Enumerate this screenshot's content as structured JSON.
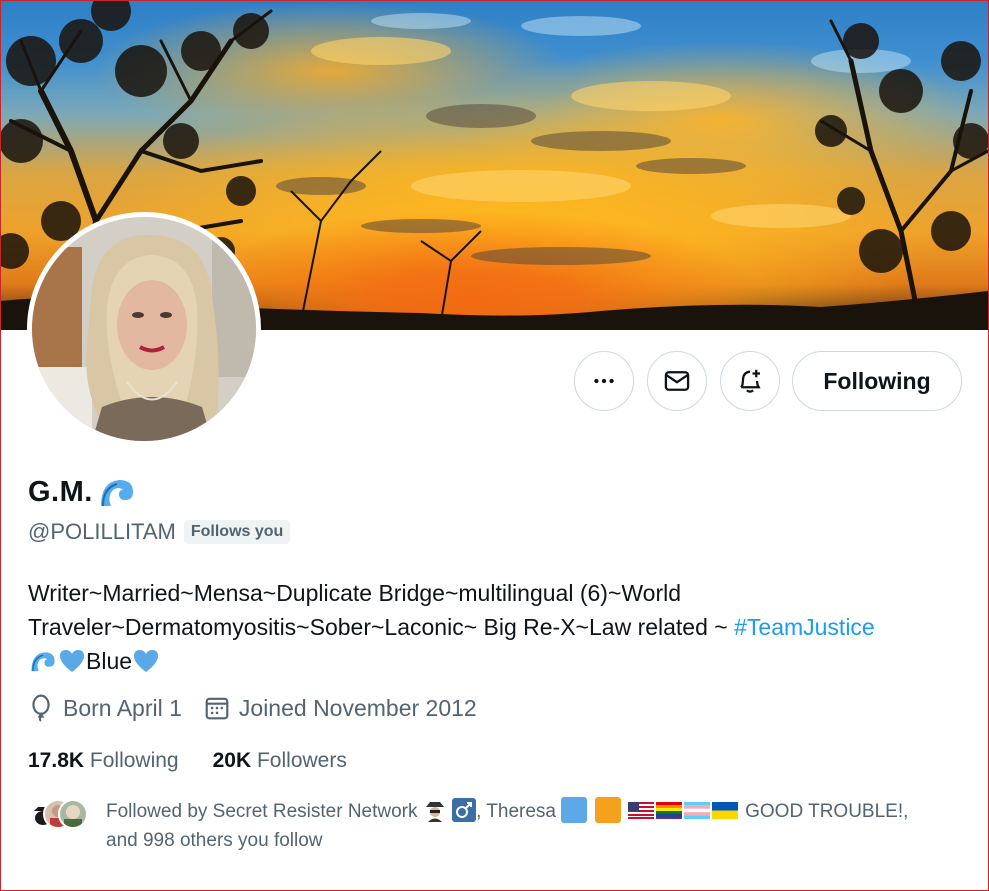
{
  "profile": {
    "display_name": "G.M.",
    "handle": "@POLILLITAM",
    "follows_you_label": "Follows you",
    "bio": {
      "line1": "Writer~Married~Mensa~Duplicate Bridge~multilingual (6)~World",
      "line2_text": "Traveler~Dermatomyositis~Sober~Laconic~ Big Re-X~Law related ~ ",
      "hashtag": "#TeamJustice",
      "line3_text": "Blue"
    },
    "born": "Born April 1",
    "joined": "Joined November 2012",
    "following_count": "17.8K",
    "following_label": "Following",
    "followers_count": "20K",
    "followers_label": "Followers",
    "followed_by": {
      "prefix": "Followed by Secret Resister Network",
      "sep1": ", Theresa",
      "suffix": "GOOD TROUBLE!,",
      "line2": "and 998 others you follow"
    }
  },
  "actions": {
    "following_button": "Following"
  },
  "icons": {
    "more": "more-icon",
    "message": "mail-icon",
    "notify": "bell-plus-icon",
    "birthday": "balloon-icon",
    "calendar": "calendar-icon"
  },
  "colors": {
    "link": "#1d9bf0",
    "secondary_text": "#536471",
    "primary_text": "#0f1419",
    "heart": "#5aa9e6"
  }
}
